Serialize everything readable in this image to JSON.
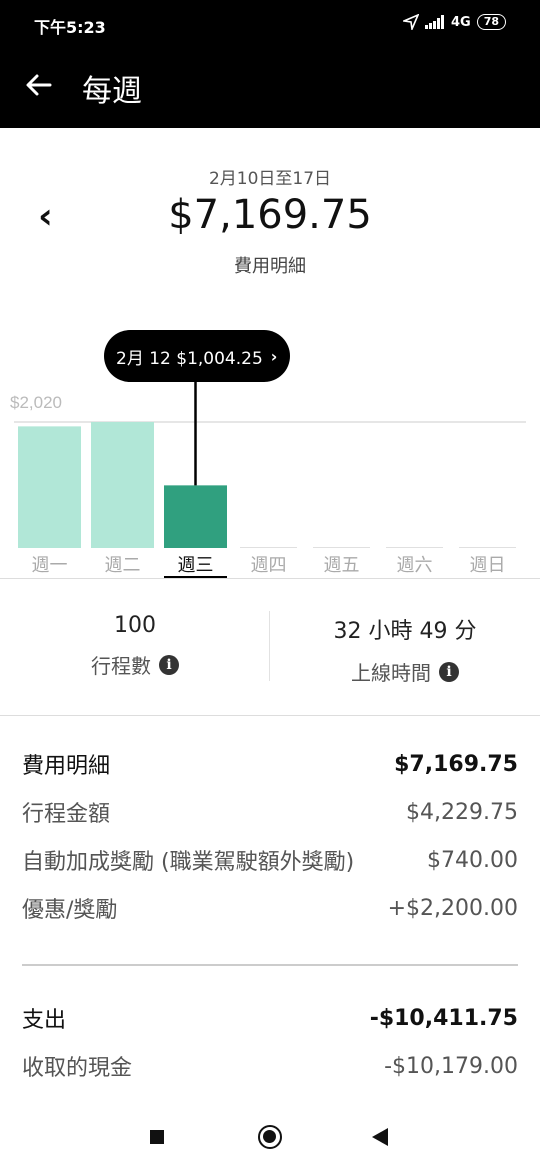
{
  "status_bar": {
    "time": "下午5:23",
    "network": "4G",
    "battery": "78"
  },
  "app_bar": {
    "title": "每週"
  },
  "summary": {
    "week_range": "2月10日至17日",
    "total": "$7,169.75",
    "breakdown_link": "費用明細"
  },
  "tooltip": {
    "label": "2月 12 $1,004.25"
  },
  "chart_data": {
    "type": "bar",
    "categories": [
      "週一",
      "週二",
      "週三",
      "週四",
      "週五",
      "週六",
      "週日"
    ],
    "values": [
      1950,
      2020,
      1004.25,
      0,
      0,
      0,
      0
    ],
    "selected_index": 2,
    "ylim": [
      0,
      2020
    ],
    "reference_line_label": "$2,020",
    "colors": {
      "bar": "#b1e7d7",
      "selected_bar": "#30a07f",
      "gridline": "#cccccc",
      "empty_bar": "#e0e0e0"
    }
  },
  "stats": [
    {
      "value": "100",
      "label": "行程數"
    },
    {
      "value": "32 小時 49 分",
      "label": "上線時間"
    }
  ],
  "earnings": [
    {
      "label": "費用明細",
      "amount": "$7,169.75"
    },
    {
      "label": "行程金額",
      "amount": "$4,229.75"
    },
    {
      "label": "自動加成獎勵 (職業駕駛額外獎勵)",
      "amount": "$740.00"
    },
    {
      "label": "優惠/獎勵",
      "amount": "+$2,200.00"
    }
  ],
  "payouts": [
    {
      "label": "支出",
      "amount": "-$10,411.75"
    },
    {
      "label": "收取的現金",
      "amount": "-$10,179.00"
    }
  ]
}
